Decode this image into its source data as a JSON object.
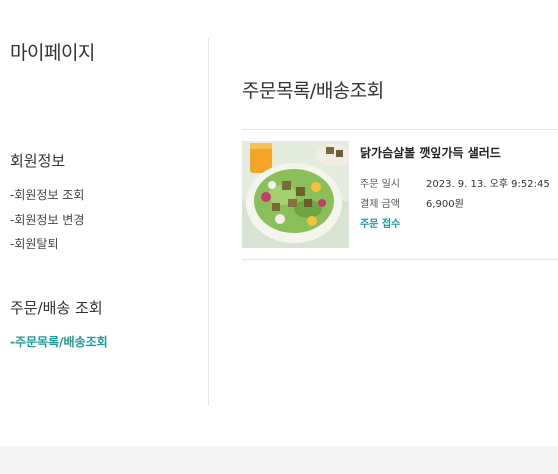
{
  "sidebar": {
    "title": "마이페이지",
    "member_section": {
      "title": "회원정보",
      "links": [
        "-회원정보 조회",
        "-회원정보 변경",
        "-회원탈퇴"
      ]
    },
    "order_section": {
      "title": "주문/배송 조회",
      "links": [
        "-주문목록/배송조회"
      ]
    }
  },
  "main": {
    "title": "주문목록/배송조회",
    "order": {
      "product_name": "닭가슴살볼 깻잎가득 샐러드",
      "date_label": "주문 일시",
      "date_value": "2023. 9. 13. 오후 9:52:45",
      "amount_label": "결제 금액",
      "amount_value": "6,900원",
      "status": "주문 접수"
    }
  },
  "colors": {
    "accent": "#1e9a9a",
    "divider": "#e6e6e6",
    "footer": "#f4f4f4"
  }
}
